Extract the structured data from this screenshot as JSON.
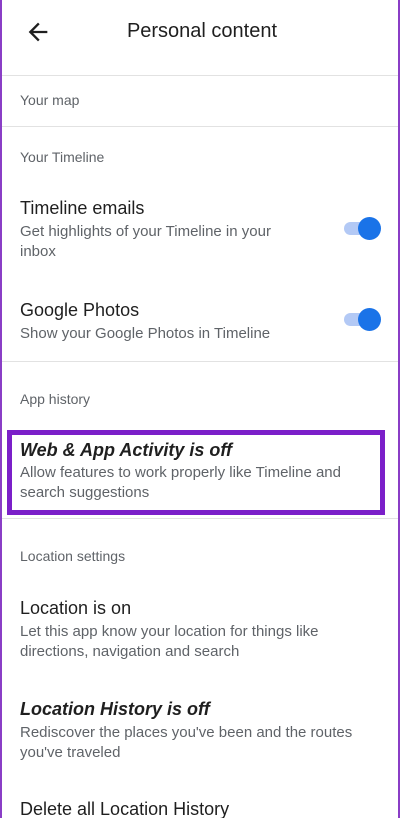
{
  "header": {
    "title": "Personal content"
  },
  "sections": {
    "your_map": "Your map",
    "your_timeline": "Your Timeline",
    "app_history": "App history",
    "location_settings": "Location settings"
  },
  "timeline_emails": {
    "title": "Timeline emails",
    "subtitle_line1": "Get highlights of your Timeline in your",
    "subtitle_line2": "inbox",
    "enabled": true
  },
  "google_photos": {
    "title": "Google Photos",
    "subtitle": "Show your Google Photos in Timeline",
    "enabled": true
  },
  "web_app_activity": {
    "title": "Web & App Activity is off",
    "subtitle_line1": "Allow features to work properly like Timeline and",
    "subtitle_line2": "search suggestions"
  },
  "location_on": {
    "title": "Location is on",
    "subtitle_line1": "Let this app know your location for things like",
    "subtitle_line2": "directions, navigation and search"
  },
  "location_history": {
    "title": "Location History is off",
    "subtitle_line1": "Rediscover the places you've been and the routes",
    "subtitle_line2": "you've traveled"
  },
  "delete_history": {
    "title": "Delete all Location History"
  },
  "colors": {
    "accent": "#1a73e8",
    "highlight": "#7b1fc9"
  }
}
